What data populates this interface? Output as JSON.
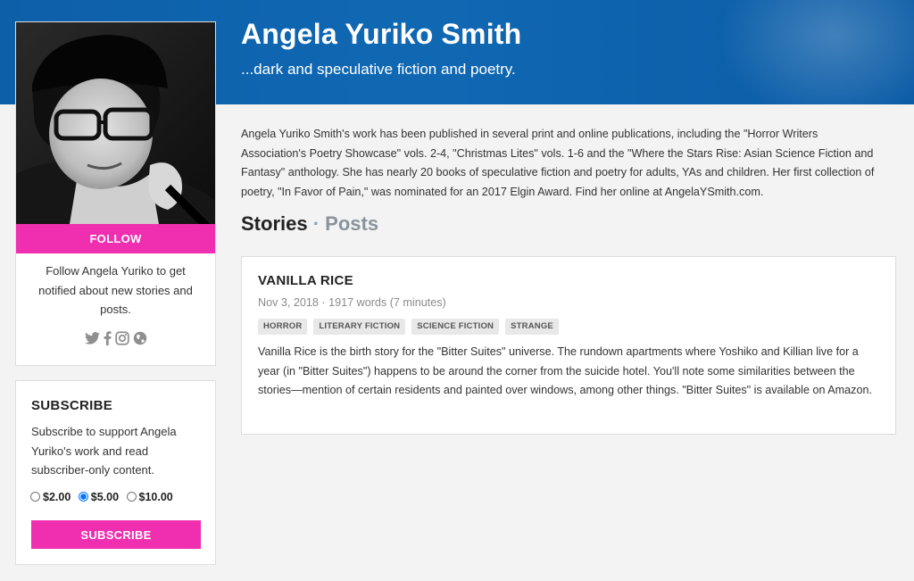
{
  "header": {
    "author_name": "Angela Yuriko Smith",
    "tagline": "...dark and speculative fiction and poetry."
  },
  "profile": {
    "follow_label": "FOLLOW",
    "follow_text": "Follow Angela Yuriko to get notified about new stories and posts.",
    "social_icons": [
      "twitter-icon",
      "facebook-icon",
      "instagram-icon",
      "globe-icon"
    ]
  },
  "subscribe": {
    "title": "SUBSCRIBE",
    "text": "Subscribe to support Angela Yuriko's work and read subscriber-only content.",
    "options": [
      {
        "label": "$2.00",
        "selected": false
      },
      {
        "label": "$5.00",
        "selected": true
      },
      {
        "label": "$10.00",
        "selected": false
      }
    ],
    "button_label": "SUBSCRIBE"
  },
  "bio": "Angela Yuriko Smith's work has been published in several print and online publications, including the \"Horror Writers Association's Poetry Showcase\" vols. 2-4, \"Christmas Lites\" vols. 1-6 and the \"Where the Stars Rise: Asian Science Fiction and Fantasy\" anthology. She has nearly 20 books of speculative fiction and poetry for adults, YAs and children. Her first collection of poetry, \"In Favor of Pain,\" was nominated for an 2017 Elgin Award. Find her online at AngelaYSmith.com.",
  "tabs": {
    "stories": "Stories",
    "separator": " · ",
    "posts": "Posts"
  },
  "story": {
    "title": "VANILLA RICE",
    "meta": "Nov 3, 2018 · 1917 words (7 minutes)",
    "tags": [
      "HORROR",
      "LITERARY FICTION",
      "SCIENCE FICTION",
      "STRANGE"
    ],
    "excerpt": "Vanilla Rice is the birth story for the \"Bitter Suites\" universe. The rundown apartments where Yoshiko and Killian live for a year (in \"Bitter Suites\") happens to be around the corner from the suicide hotel. You'll note some similarities between the stories—mention of certain residents and painted over windows, among other things. \"Bitter Suites\" is available on Amazon."
  },
  "colors": {
    "banner": "#0d5fa8",
    "accent_pink": "#ef2faf",
    "background": "#f3f3f3"
  }
}
